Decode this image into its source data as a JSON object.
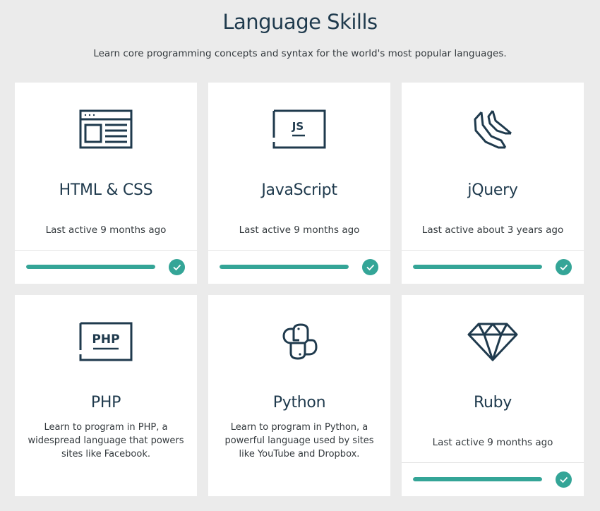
{
  "header": {
    "title": "Language Skills",
    "subtitle": "Learn core programming concepts and syntax for the world's most popular languages."
  },
  "cards": [
    {
      "title": "HTML & CSS",
      "icon": "html-browser-icon",
      "last_active": "Last active 9 months ago",
      "progress": 1.0
    },
    {
      "title": "JavaScript",
      "icon": "javascript-icon",
      "icon_text": "JS",
      "last_active": "Last active 9 months ago",
      "progress": 1.0
    },
    {
      "title": "jQuery",
      "icon": "jquery-icon",
      "last_active": "Last active about 3 years ago",
      "progress": 1.0
    },
    {
      "title": "PHP",
      "icon": "php-icon",
      "icon_text": "PHP",
      "description": "Learn to program in PHP, a widespread language that powers sites like Facebook."
    },
    {
      "title": "Python",
      "icon": "python-icon",
      "description": "Learn to program in Python, a powerful language used by sites like YouTube and Dropbox."
    },
    {
      "title": "Ruby",
      "icon": "ruby-gem-icon",
      "last_active": "Last active 9 months ago",
      "progress": 1.0
    }
  ],
  "colors": {
    "accent": "#34a597",
    "text_dark": "#1f3a4d",
    "background": "#ebebeb",
    "card": "#ffffff"
  }
}
